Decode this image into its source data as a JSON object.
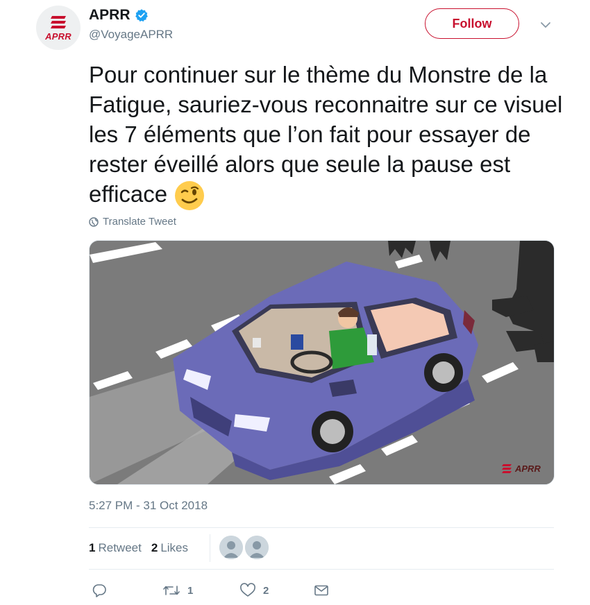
{
  "author": {
    "display_name": "APRR",
    "handle": "@VoyageAPRR",
    "avatar_logo_text": "APRR",
    "verified_icon": "verified-badge-icon"
  },
  "header": {
    "follow_label": "Follow",
    "menu_icon": "chevron-down-icon"
  },
  "tweet": {
    "text": "Pour continuer sur le thème du Monstre de la Fatigue, sauriez-vous reconnaitre sur ce visuel les 7 éléments que l’on fait pour essayer de rester éveillé alors que seule la pause est efficace",
    "emoji": "winking-face-emoji",
    "translate_label": "Translate Tweet",
    "timestamp": "5:27 PM - 31 Oct 2018"
  },
  "media": {
    "watermark_text": "APRR",
    "colors": {
      "road": "#7a7a7a",
      "car": "#6e6ebd",
      "brand": "#c8102e"
    }
  },
  "stats": {
    "retweet_count": "1",
    "retweet_label": "Retweet",
    "like_count": "2",
    "like_label": "Likes"
  },
  "actions": {
    "reply_icon": "reply-icon",
    "retweet_icon": "retweet-icon",
    "retweet_count": "1",
    "like_icon": "heart-icon",
    "like_count": "2",
    "dm_icon": "envelope-icon"
  },
  "colors": {
    "accent": "#c8102e",
    "muted": "#657786",
    "text": "#14171a",
    "verified": "#1da1f2"
  }
}
